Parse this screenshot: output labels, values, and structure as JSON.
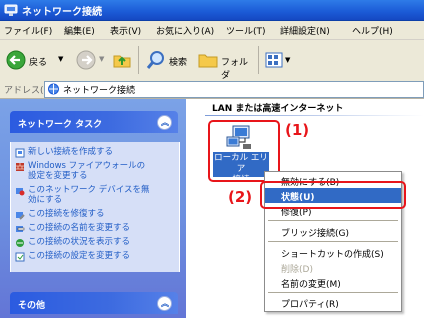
{
  "window": {
    "title": "ネットワーク接続"
  },
  "menubar": {
    "items": [
      "ファイル(F)",
      "編集(E)",
      "表示(V)",
      "お気に入り(A)",
      "ツール(T)",
      "詳細設定(N)",
      "ヘルプ(H)"
    ]
  },
  "toolbar": {
    "back_label": "戻る",
    "search_label": "検索",
    "folders_label": "フォルダ"
  },
  "address": {
    "label": "アドレス(D)",
    "value": "ネットワーク接続"
  },
  "tasks_panel": {
    "title": "ネットワーク タスク",
    "items": [
      {
        "label_lines": [
          "新しい接続を作成する"
        ],
        "icon": "new-connection-icon"
      },
      {
        "label_lines": [
          "Windows ファイアウォールの",
          "設定を変更する"
        ],
        "icon": "firewall-icon"
      },
      {
        "label_lines": [
          "このネットワーク デバイスを無",
          "効にする"
        ],
        "icon": "disable-device-icon"
      },
      {
        "label_lines": [
          "この接続を修復する"
        ],
        "icon": "repair-icon"
      },
      {
        "label_lines": [
          "この接続の名前を変更する"
        ],
        "icon": "rename-icon"
      },
      {
        "label_lines": [
          "この接続の状況を表示する"
        ],
        "icon": "status-icon"
      },
      {
        "label_lines": [
          "この接続の設定を変更する"
        ],
        "icon": "settings-icon"
      }
    ]
  },
  "other_panel": {
    "title": "その他"
  },
  "content": {
    "section_title": "LAN または高速インターネット",
    "connection": {
      "label_lines": [
        "ローカル エリア",
        "接続"
      ]
    }
  },
  "context_menu": {
    "items": [
      {
        "label": "無効にする(B)",
        "state": "normal"
      },
      {
        "label": "状態(U)",
        "state": "selected"
      },
      {
        "label": "修復(P)",
        "state": "normal"
      },
      {
        "label": "ブリッジ接続(G)",
        "state": "normal"
      },
      {
        "label": "ショートカットの作成(S)",
        "state": "normal"
      },
      {
        "label": "削除(D)",
        "state": "disabled"
      },
      {
        "label": "名前の変更(M)",
        "state": "normal"
      },
      {
        "label": "プロパティ(R)",
        "state": "normal"
      }
    ]
  },
  "annotations": {
    "callout_1": "(1)",
    "callout_2": "(2)",
    "highlight_color": "#e8151a"
  },
  "colors": {
    "xp_blue": "#1b5ad6",
    "link_blue": "#215dc6",
    "selection": "#316ac5",
    "panel_bg": "#d6dff7"
  }
}
